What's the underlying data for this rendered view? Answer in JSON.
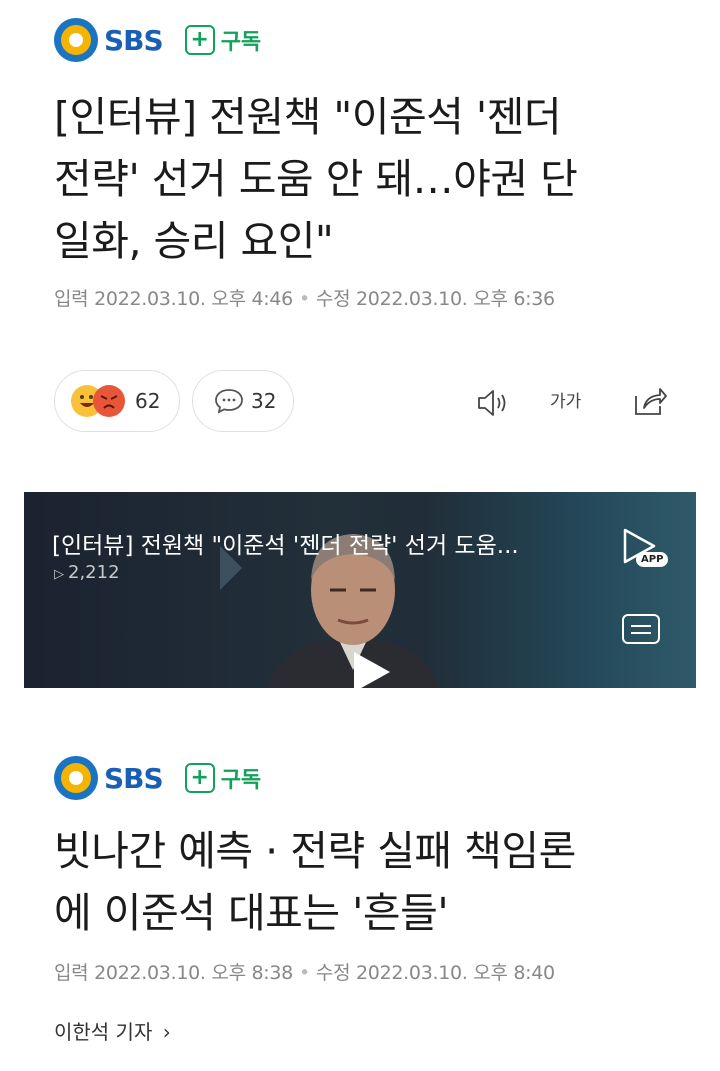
{
  "article1": {
    "brand": "SBS",
    "subscribe_label": "구독",
    "headline_lines": [
      "[인터뷰] 전원책 \"이준석 '젠더",
      "전략' 선거 도움 안 돼…야권 단",
      "일화, 승리 요인\""
    ],
    "input_label": "입력",
    "input_time": "2022.03.10. 오후 4:46",
    "edit_label": "수정",
    "edit_time": "2022.03.10. 오후 6:36"
  },
  "reactions": {
    "reaction_count": "62",
    "comment_count": "32"
  },
  "toolbar": {
    "font_size_label": "가가",
    "icons": [
      "speaker-icon",
      "font-size-icon",
      "share-icon"
    ]
  },
  "video": {
    "title": "[인터뷰] 전원책 \"이준석 '젠더 전략' 선거 도움...",
    "views": "2,212",
    "app_badge": "APP"
  },
  "article2": {
    "brand": "SBS",
    "subscribe_label": "구독",
    "headline_lines": [
      "빗나간 예측 · 전략 실패 책임론",
      "에 이준석 대표는 '흔들'"
    ],
    "input_label": "입력",
    "input_time": "2022.03.10. 오후 8:38",
    "edit_label": "수정",
    "edit_time": "2022.03.10. 오후 8:40",
    "reporter": "이한석 기자",
    "reporter_arrow": "›"
  },
  "colors": {
    "sbs_blue": "#1a74c2",
    "sbs_yellow": "#f5b400",
    "subscribe_green": "#12a15a"
  }
}
